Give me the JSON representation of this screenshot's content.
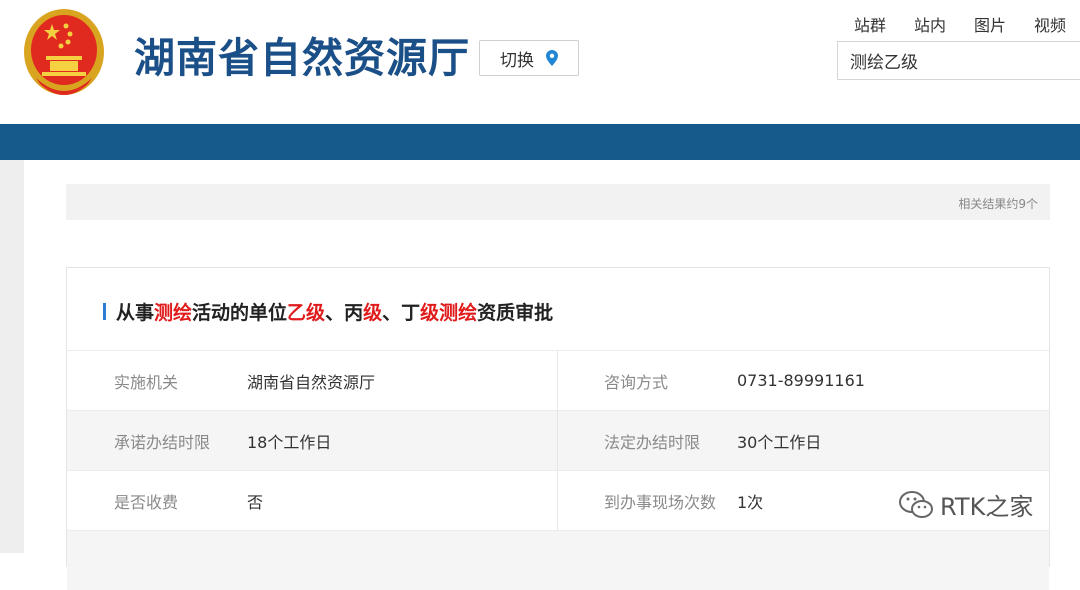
{
  "header": {
    "site_title": "湖南省自然资源厅",
    "switch_label": "切换",
    "nav": [
      "站群",
      "站内",
      "图片",
      "视频"
    ],
    "search_value": "测绘乙级"
  },
  "results": {
    "count_text": "相关结果约9个"
  },
  "card": {
    "title_parts": [
      {
        "text": "从事",
        "hl": false
      },
      {
        "text": "测绘",
        "hl": true
      },
      {
        "text": "活动的单位",
        "hl": false
      },
      {
        "text": "乙级",
        "hl": true
      },
      {
        "text": "、丙",
        "hl": false
      },
      {
        "text": "级",
        "hl": true
      },
      {
        "text": "、丁",
        "hl": false
      },
      {
        "text": "级测绘",
        "hl": true
      },
      {
        "text": "资质审批",
        "hl": false
      }
    ],
    "rows": [
      {
        "l_label": "实施机关",
        "l_value": "湖南省自然资源厅",
        "r_label": "咨询方式",
        "r_value": "0731-89991161"
      },
      {
        "l_label": "承诺办结时限",
        "l_value": "18个工作日",
        "r_label": "法定办结时限",
        "r_value": "30个工作日"
      },
      {
        "l_label": "是否收费",
        "l_value": "否",
        "r_label": "到办事现场次数",
        "r_value": "1次"
      }
    ]
  },
  "watermark": "RTK之家",
  "colors": {
    "brand_blue": "#1a4f88",
    "bar_blue": "#165a8c",
    "highlight_red": "#e01b1b"
  }
}
